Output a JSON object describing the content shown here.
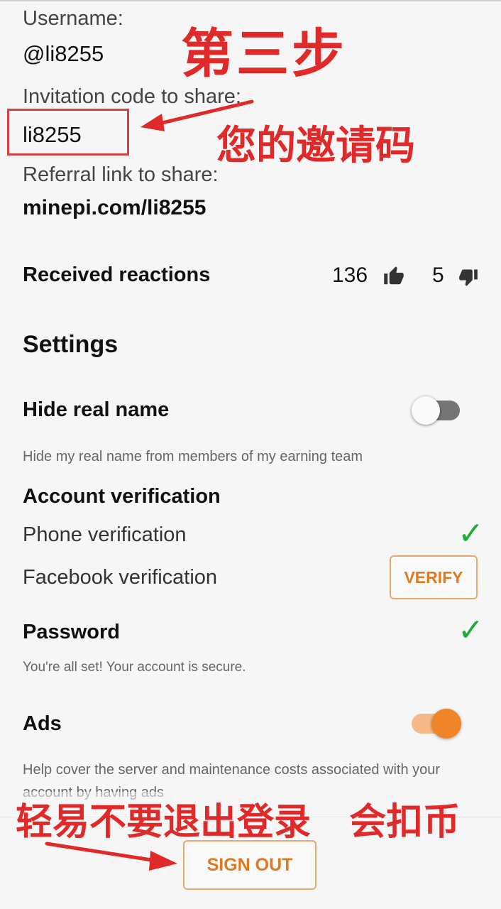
{
  "username": {
    "label": "Username:",
    "value": "@li8255"
  },
  "invitation": {
    "label": "Invitation code to share:",
    "value": "li8255"
  },
  "referral": {
    "label": "Referral link to share:",
    "value": "minepi.com/li8255"
  },
  "reactions": {
    "label": "Received reactions",
    "likes": "136",
    "dislikes": "5"
  },
  "settings": {
    "title": "Settings"
  },
  "hide_real_name": {
    "title": "Hide real name",
    "description": "Hide my real name from members of my earning team",
    "enabled": false
  },
  "account_verification": {
    "title": "Account verification",
    "phone_label": "Phone verification",
    "facebook_label": "Facebook verification",
    "verify_button": "VERIFY"
  },
  "password": {
    "title": "Password",
    "description": "You're all set! Your account is secure."
  },
  "ads": {
    "title": "Ads",
    "description_line1": "Help cover the server and maintenance costs associated with your",
    "description_line2": "account by having ads",
    "enabled": true
  },
  "sign_out_button": "SIGN OUT",
  "annotations": {
    "step_title": "第三步",
    "invite_code_note": "您的邀请码",
    "warning_note": "轻易不要退出登录   会扣币"
  },
  "colors": {
    "accent_orange": "#f08428",
    "check_green": "#1fad3a",
    "annotation_red": "#e02a2a"
  }
}
